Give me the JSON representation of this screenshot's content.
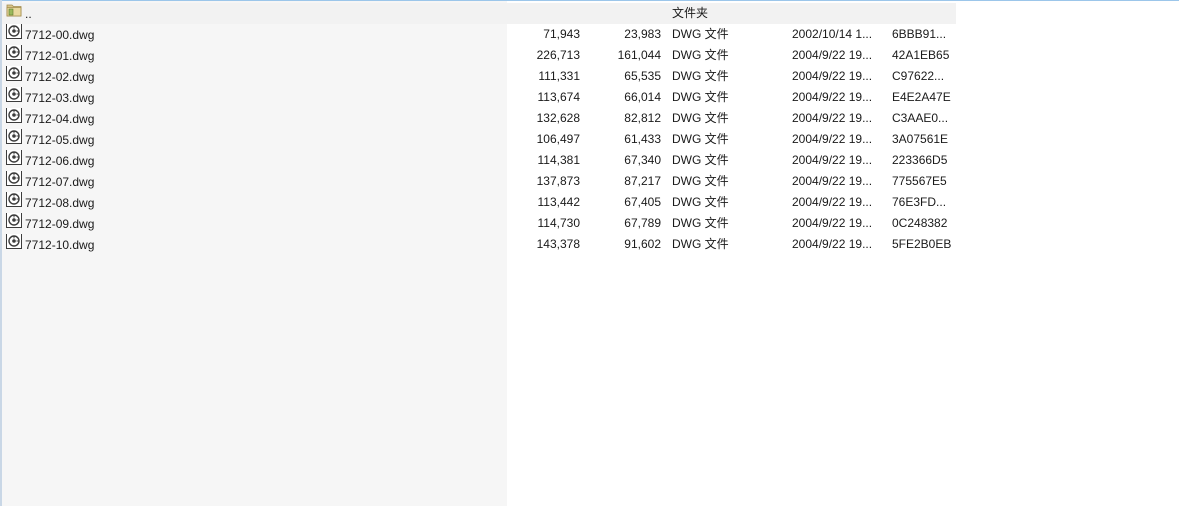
{
  "parent_row": {
    "name": "..",
    "type": "文件夹",
    "icon": "folder-up-icon"
  },
  "file_icon": "dwg-file-icon",
  "files": [
    {
      "name": "7712-00.dwg",
      "size": "71,943",
      "packed": "23,983",
      "type": "DWG 文件",
      "modified": "2002/10/14 1...",
      "crc": "6BBB91..."
    },
    {
      "name": "7712-01.dwg",
      "size": "226,713",
      "packed": "161,044",
      "type": "DWG 文件",
      "modified": "2004/9/22 19...",
      "crc": "42A1EB65"
    },
    {
      "name": "7712-02.dwg",
      "size": "111,331",
      "packed": "65,535",
      "type": "DWG 文件",
      "modified": "2004/9/22 19...",
      "crc": "C97622..."
    },
    {
      "name": "7712-03.dwg",
      "size": "113,674",
      "packed": "66,014",
      "type": "DWG 文件",
      "modified": "2004/9/22 19...",
      "crc": "E4E2A47E"
    },
    {
      "name": "7712-04.dwg",
      "size": "132,628",
      "packed": "82,812",
      "type": "DWG 文件",
      "modified": "2004/9/22 19...",
      "crc": "C3AAE0..."
    },
    {
      "name": "7712-05.dwg",
      "size": "106,497",
      "packed": "61,433",
      "type": "DWG 文件",
      "modified": "2004/9/22 19...",
      "crc": "3A07561E"
    },
    {
      "name": "7712-06.dwg",
      "size": "114,381",
      "packed": "67,340",
      "type": "DWG 文件",
      "modified": "2004/9/22 19...",
      "crc": "223366D5"
    },
    {
      "name": "7712-07.dwg",
      "size": "137,873",
      "packed": "87,217",
      "type": "DWG 文件",
      "modified": "2004/9/22 19...",
      "crc": "775567E5"
    },
    {
      "name": "7712-08.dwg",
      "size": "113,442",
      "packed": "67,405",
      "type": "DWG 文件",
      "modified": "2004/9/22 19...",
      "crc": "76E3FD..."
    },
    {
      "name": "7712-09.dwg",
      "size": "114,730",
      "packed": "67,789",
      "type": "DWG 文件",
      "modified": "2004/9/22 19...",
      "crc": "0C248382"
    },
    {
      "name": "7712-10.dwg",
      "size": "143,378",
      "packed": "91,602",
      "type": "DWG 文件",
      "modified": "2004/9/22 19...",
      "crc": "5FE2B0EB"
    }
  ]
}
